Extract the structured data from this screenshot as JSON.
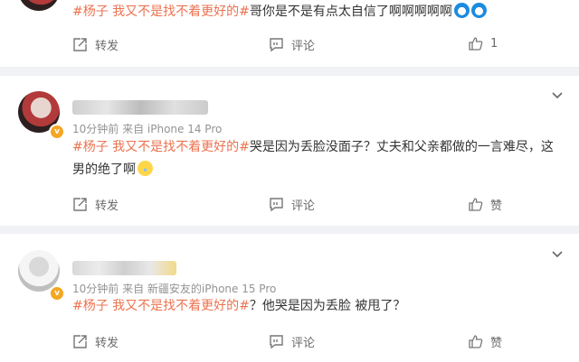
{
  "comments": [
    {
      "topic": "#杨子 我又不是找不着更好的#",
      "text": "哥你是不是有点太自信了啊啊啊啊啊",
      "emojis": [
        "blue-emoji",
        "blue-emoji"
      ],
      "actions": {
        "repost": "转发",
        "comment": "评论",
        "like": "1"
      }
    },
    {
      "meta": "10分钟前  来自 iPhone 14 Pro",
      "topic": "#杨子 我又不是找不着更好的#",
      "text_line1": "哭是因为丢脸没面子？丈夫和父亲都做的一言难尽，这",
      "text_line2": "男的绝了啊",
      "emoji": "cry-emoji",
      "actions": {
        "repost": "转发",
        "comment": "评论",
        "like": "赞"
      }
    },
    {
      "meta": "10分钟前  来自 新疆安友的iPhone 15 Pro",
      "topic": "#杨子 我又不是找不着更好的#",
      "text": "？他哭是因为丢脸 被甩了？",
      "actions": {
        "repost": "转发",
        "comment": "评论",
        "like": "赞"
      }
    }
  ],
  "colors": {
    "topic": "#eb7350",
    "meta": "#939393",
    "background": "#f1f2f5"
  }
}
